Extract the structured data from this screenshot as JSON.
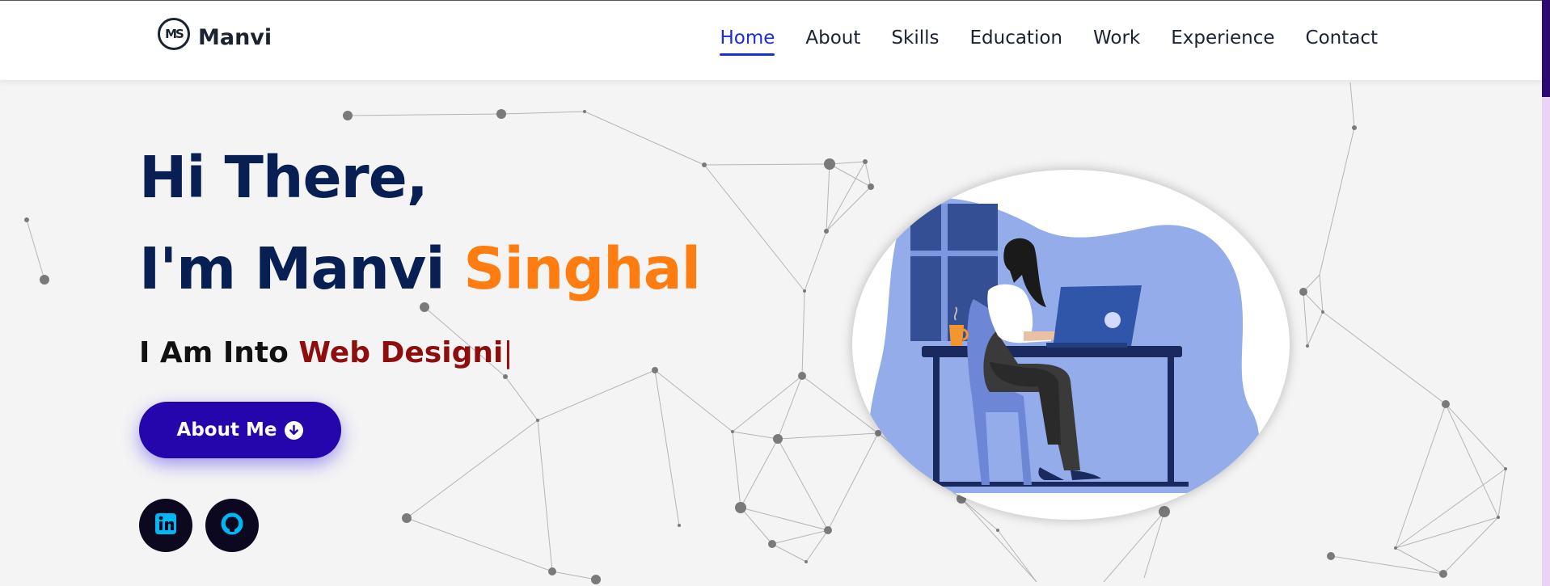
{
  "logo": {
    "monogram": "MS",
    "name": "Manvi"
  },
  "nav": {
    "items": [
      {
        "label": "Home",
        "active": true
      },
      {
        "label": "About",
        "active": false
      },
      {
        "label": "Skills",
        "active": false
      },
      {
        "label": "Education",
        "active": false
      },
      {
        "label": "Work",
        "active": false
      },
      {
        "label": "Experience",
        "active": false
      },
      {
        "label": "Contact",
        "active": false
      }
    ],
    "active_color": "#1a2dd8",
    "text_color": "#1b2331"
  },
  "hero": {
    "greeting": "Hi There,",
    "intro": "I'm Manvi",
    "surname": "Singhal",
    "typing_prefix": "I Am Into",
    "typing_word": "Web Designi",
    "caret": "|",
    "cta_label": "About Me",
    "cta_icon": "arrow-circle-down-icon",
    "title_color": "#071f52",
    "accent_color": "#ff7c10",
    "typing_color": "#8e0d0d",
    "cta_color": "#2506ad"
  },
  "social": [
    {
      "name": "linkedin",
      "icon": "linkedin-icon",
      "icon_color": "#00b7f5"
    },
    {
      "name": "github",
      "icon": "github-icon",
      "icon_color": "#00b7f5"
    }
  ],
  "illustration": {
    "subject": "woman-working-on-laptop-icon"
  },
  "background": {
    "type": "particle-network",
    "color": "#f4f4f4"
  }
}
